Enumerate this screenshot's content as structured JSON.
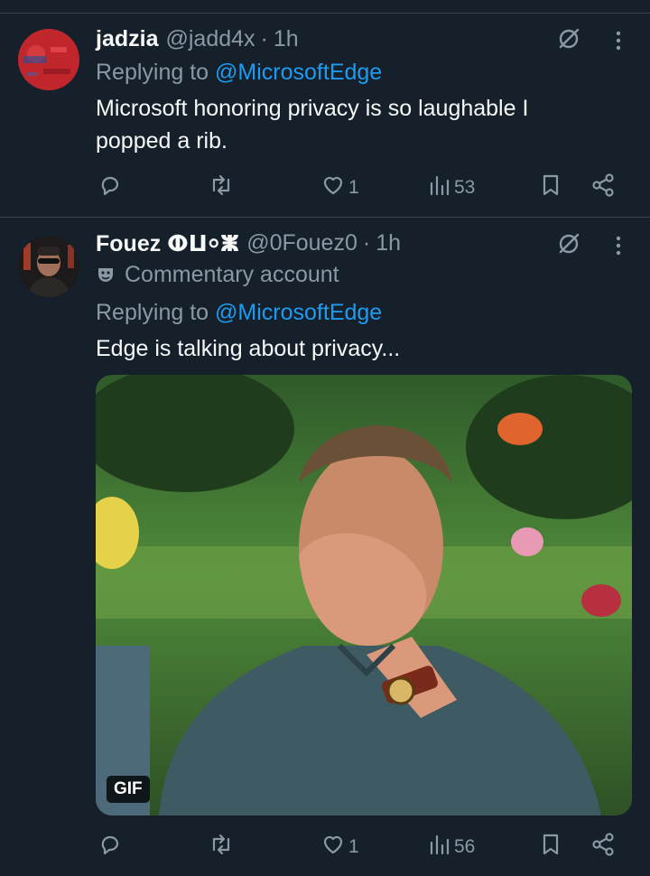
{
  "tweets": [
    {
      "name": "jadzia",
      "handle": "@jadd4x",
      "separator": "·",
      "time": "1h",
      "replying_prefix": "Replying to",
      "replying_to": "@MicrosoftEdge",
      "text": "Microsoft honoring privacy is so laughable I popped a rib.",
      "actions": {
        "replies": "",
        "retweets": "",
        "likes": "1",
        "views": "53"
      }
    },
    {
      "name": "Fouez ⵀⵡ⸰ⵥ",
      "handle": "@0Fouez0",
      "separator": "·",
      "time": "1h",
      "account_label": "Commentary account",
      "replying_prefix": "Replying to",
      "replying_to": "@MicrosoftEdge",
      "text": "Edge is talking about privacy...",
      "media": {
        "badge": "GIF"
      },
      "actions": {
        "replies": "",
        "retweets": "",
        "likes": "1",
        "views": "56"
      }
    }
  ],
  "colors": {
    "background": "#15202b",
    "accent": "#1d9bf0",
    "muted": "#8b98a5",
    "divider": "#38444d"
  },
  "icons": [
    "grok-icon",
    "more-icon",
    "reply-icon",
    "retweet-icon",
    "like-icon",
    "views-icon",
    "bookmark-icon",
    "share-icon",
    "commentary-mask-icon"
  ]
}
